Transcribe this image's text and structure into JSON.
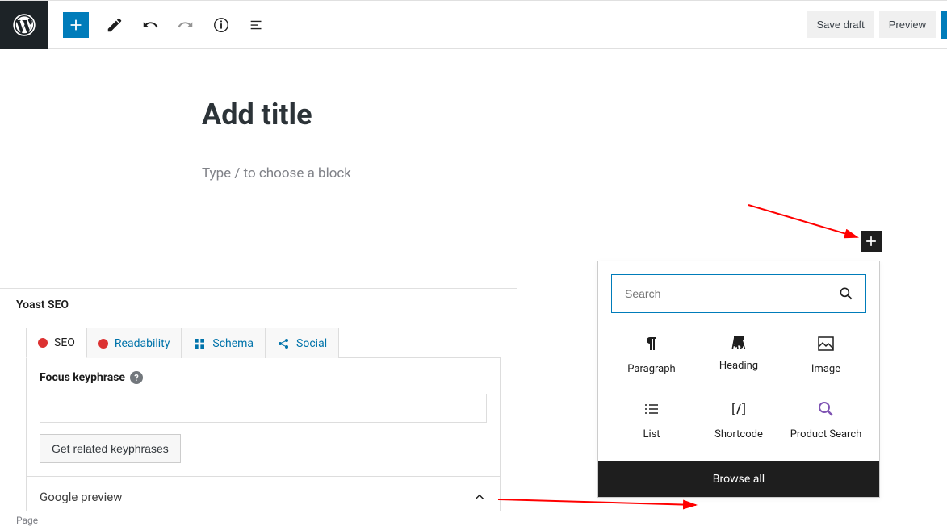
{
  "topbar": {
    "save_draft": "Save draft",
    "preview": "Preview"
  },
  "editor": {
    "title_placeholder": "Add title",
    "block_placeholder": "Type / to choose a block"
  },
  "inserter": {
    "search_placeholder": "Search",
    "items": {
      "paragraph": "Paragraph",
      "heading": "Heading",
      "image": "Image",
      "list": "List",
      "shortcode": "Shortcode",
      "product_search": "Product Search"
    },
    "browse_all": "Browse all"
  },
  "yoast": {
    "panel_title": "Yoast SEO",
    "tabs": {
      "seo": "SEO",
      "readability": "Readability",
      "schema": "Schema",
      "social": "Social"
    },
    "focus_label": "Focus keyphrase",
    "related_btn": "Get related keyphrases",
    "google_preview": "Google preview"
  },
  "footer": {
    "page": "Page"
  }
}
